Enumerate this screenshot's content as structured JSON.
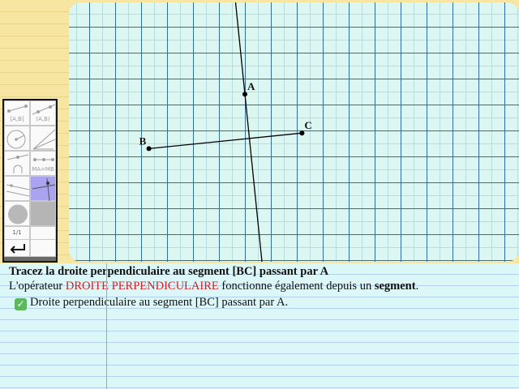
{
  "canvas": {
    "points": [
      {
        "name": "A",
        "x": 1.0,
        "y": 4.4
      },
      {
        "name": "B",
        "x": -2.7,
        "y": 2.3
      },
      {
        "name": "C",
        "x": 3.2,
        "y": 2.9
      }
    ],
    "colors": {
      "grid_major": "#2f6fa6",
      "grid_minor": "#b7dcdd",
      "background": "#dcf6f2",
      "lines": "#000000"
    }
  },
  "toolbar": {
    "tool_ray_label": "[A,B]",
    "tool_segment_label": "(A,B)",
    "tool_midpoint_label": "MA=MB",
    "page_indicator": "1/1",
    "undo_icon": "undo-arrow-icon"
  },
  "instructions": {
    "title": "Tracez la droite perpendiculaire au segment [BC] passant par A",
    "info_prefix": "L'opérateur ",
    "info_operator": "DROITE PERPENDICULAIRE",
    "info_middle": " fonctionne également depuis un ",
    "info_bold": "segment",
    "info_suffix": ".",
    "result": "Droite perpendiculaire au segment [BC] passant par A.",
    "result_icon": "check-icon"
  }
}
